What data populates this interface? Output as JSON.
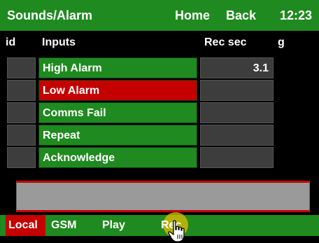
{
  "header": {
    "title": "Sounds/Alarm",
    "home_label": "Home",
    "back_label": "Back",
    "time": "12:23"
  },
  "table": {
    "columns": {
      "id": "id",
      "inputs": "Inputs",
      "rec_sec": "Rec sec",
      "g": "g"
    },
    "rows": [
      {
        "id": "",
        "input": "High Alarm",
        "rec_sec": "3.1",
        "state": "normal"
      },
      {
        "id": "",
        "input": "Low Alarm",
        "rec_sec": "",
        "state": "selected"
      },
      {
        "id": "",
        "input": "Comms Fail",
        "rec_sec": "",
        "state": "normal"
      },
      {
        "id": "",
        "input": "Repeat",
        "rec_sec": "",
        "state": "normal"
      },
      {
        "id": "",
        "input": "Acknowledge",
        "rec_sec": "",
        "state": "normal"
      }
    ]
  },
  "footer": {
    "local_label": "Local",
    "gsm_label": "GSM",
    "play_label": "Play",
    "rec_label": "Rec"
  },
  "icons": {
    "cursor": "hand-pointer-icon"
  },
  "colors": {
    "bar_green": "#1f8a1f",
    "selected_red": "#c40000",
    "cell_gray": "#3d3d3d",
    "rec_highlight": "#e6be00"
  }
}
